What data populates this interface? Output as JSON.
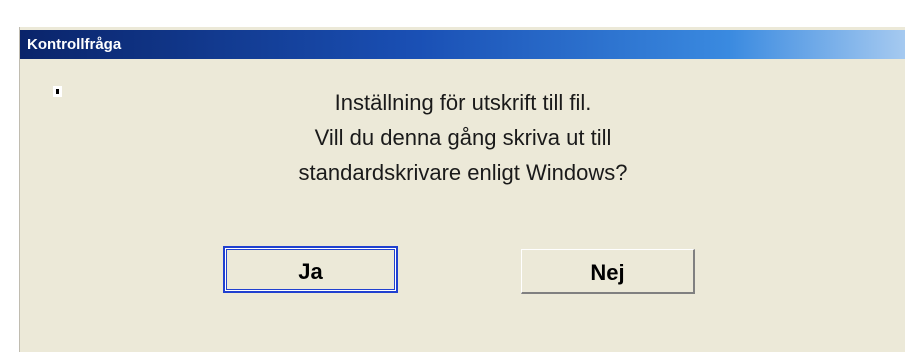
{
  "dialog": {
    "title": "Kontrollfråga",
    "icon": "small-dot-icon",
    "message_lines": [
      "Inställning för utskrift till fil.",
      "Vill du denna gång skriva ut till",
      "standardskrivare enligt Windows?"
    ],
    "buttons": {
      "yes_label": "Ja",
      "no_label": "Nej"
    },
    "colors": {
      "titlebar_start": "#0a246a",
      "titlebar_end": "#a6caf0",
      "face": "#ece9d8",
      "focus_border": "#2040d0"
    }
  }
}
